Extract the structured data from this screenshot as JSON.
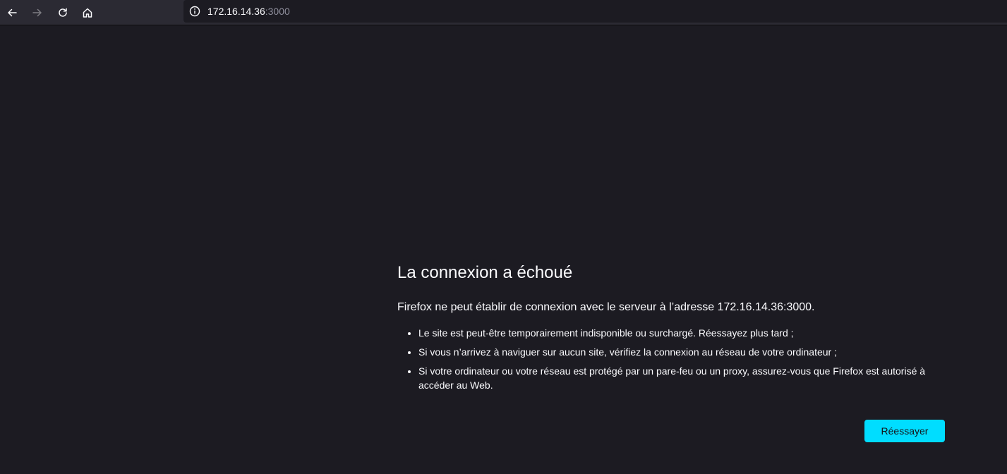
{
  "toolbar": {
    "back_icon": "arrow-left-icon",
    "forward_icon": "arrow-right-icon",
    "reload_icon": "reload-icon",
    "home_icon": "home-icon",
    "url_host": "172.16.14.36",
    "url_port": ":3000",
    "site_info_icon": "info-circle-icon"
  },
  "error_page": {
    "title": "La connexion a échoué",
    "intro": "Firefox ne peut établir de connexion avec le serveur à l’adresse 172.16.14.36:3000.",
    "items": [
      "Le site est peut-être temporairement indisponible ou surchargé. Réessayez plus tard ;",
      "Si vous n’arrivez à naviguer sur aucun site, vérifiez la connexion au réseau de votre ordinateur ;",
      "Si votre ordinateur ou votre réseau est protégé par un pare-feu ou un proxy, assurez-vous que Firefox est autorisé à accéder au Web."
    ],
    "retry_label": "Réessayer"
  },
  "colors": {
    "page_background": "#1c1b22",
    "toolbar_background": "#2b2a33",
    "accent_button": "#00ddff",
    "text": "#fbfbfe"
  }
}
